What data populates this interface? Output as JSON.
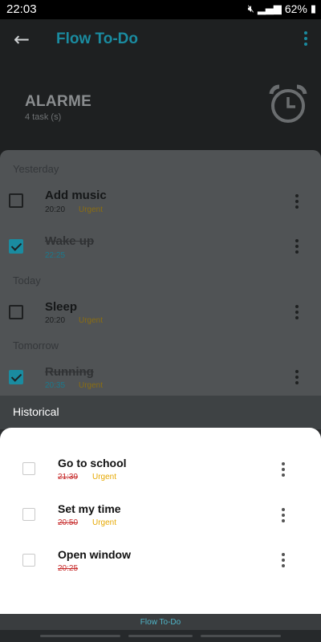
{
  "status_bar": {
    "time": "22:03",
    "battery": "62%",
    "icons": [
      "mute-icon",
      "signal-icon",
      "battery-icon"
    ]
  },
  "app_bar": {
    "title": "Flow To-Do",
    "back_icon": "back-arrow-icon",
    "menu_icon": "more-vert-icon"
  },
  "header": {
    "list_name": "ALARME",
    "task_count": "4 task (s)",
    "icon": "alarm-clock-icon"
  },
  "groups": [
    {
      "label": "Yesterday"
    },
    {
      "label": "Today"
    },
    {
      "label": "Tomorrow"
    }
  ],
  "tasks": [
    {
      "title": "Add music",
      "time": "20:20",
      "tag": "Urgent",
      "done": false
    },
    {
      "title": "Wake up",
      "time": "22:25",
      "tag": "",
      "done": true
    },
    {
      "title": "Sleep",
      "time": "20:20",
      "tag": "Urgent",
      "done": false
    },
    {
      "title": "Running",
      "time": "20:35",
      "tag": "Urgent",
      "done": true
    }
  ],
  "historical": {
    "title": "Historical",
    "items": [
      {
        "title": "Go to school",
        "time": "21:39",
        "tag": "Urgent"
      },
      {
        "title": "Set my time",
        "time": "20:50",
        "tag": "Urgent"
      },
      {
        "title": "Open window",
        "time": "20:25",
        "tag": ""
      }
    ]
  },
  "footer": {
    "label": "Flow To-Do"
  },
  "colors": {
    "accent": "#1a8ba0",
    "urgent": "#e6a800",
    "overdue": "#c62828"
  }
}
